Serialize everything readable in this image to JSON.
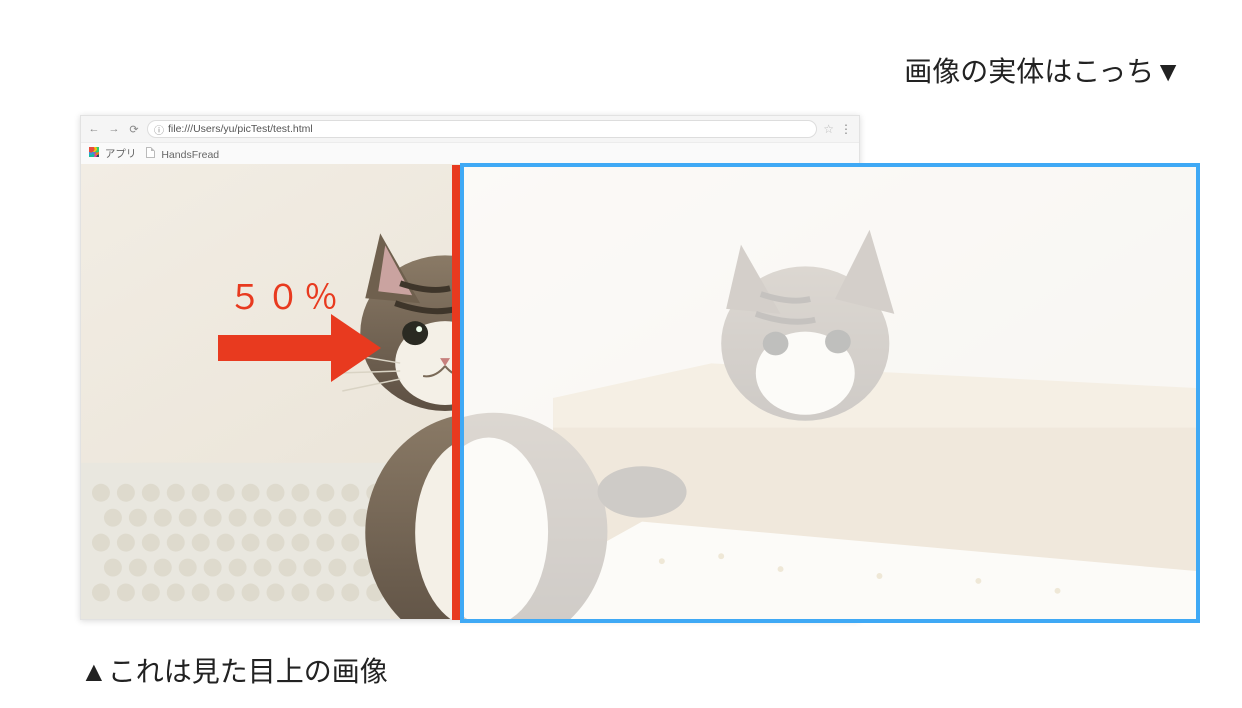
{
  "captions": {
    "top": "画像の実体はこっち▼",
    "bottom": "▲これは見た目上の画像"
  },
  "annotation": {
    "percentage_label": "５０％"
  },
  "browser": {
    "url": "file:///Users/yu/picTest/test.html",
    "bookmarks": {
      "apps_label": "アプリ",
      "item1_label": "HandsFread"
    }
  },
  "colors": {
    "accent_red": "#e83a1f",
    "highlight_blue": "#3fa9f5"
  }
}
